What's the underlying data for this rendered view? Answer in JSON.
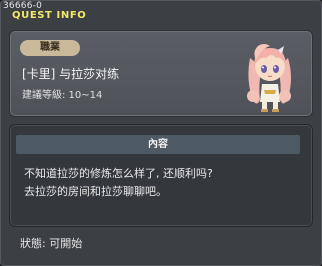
{
  "window": {
    "quest_id": "36666-0",
    "title": "QUEST INFO"
  },
  "quest": {
    "type_badge": "職業",
    "name": "[卡里] 与拉莎对练",
    "level": "建議等級: 10~14"
  },
  "content": {
    "header": "內容",
    "lines": [
      "不知道拉莎的修炼怎么样了, 还顺利吗?",
      "去拉莎的房间和拉莎聊聊吧。"
    ]
  },
  "status": "狀態: 可開始",
  "colors": {
    "title": "#f2e86a",
    "badge_bg": "#c9b89a",
    "card_bg": "#575b61",
    "content_bg": "#34373c",
    "header_bg": "#4e5a63"
  },
  "icons": {
    "npc": "npc-portrait-icon"
  }
}
